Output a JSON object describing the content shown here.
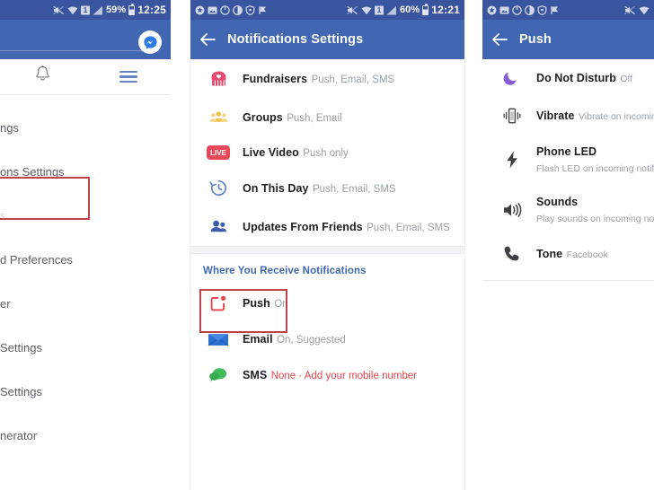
{
  "panels": {
    "left": {
      "status": {
        "battery": "59%",
        "clock": "12:25",
        "icons": [
          "mute-icon",
          "wifi-icon",
          "sim-icon",
          "signal-icon",
          "battery-icon"
        ]
      },
      "appbar": {
        "messenger_icon": "messenger-icon"
      },
      "tabs": [
        {
          "name": "notifications-tab",
          "icon": "bell-icon"
        },
        {
          "name": "menu-tab",
          "icon": "hamburger-icon"
        }
      ],
      "menu": [
        {
          "label": "ngs",
          "dim": false
        },
        {
          "label": "ons Settings",
          "dim": false,
          "highlighted": true
        },
        {
          "label": "s",
          "dim": true
        },
        {
          "label": "d Preferences",
          "dim": false
        },
        {
          "label": "er",
          "dim": false
        },
        {
          "label": "Settings",
          "dim": false
        },
        {
          "label": "Settings",
          "dim": false
        },
        {
          "label": "nerator",
          "dim": false
        }
      ]
    },
    "middle": {
      "status": {
        "battery": "60%",
        "clock": "12:21",
        "icons": [
          "star-icon",
          "image-icon",
          "power-icon",
          "pie-icon",
          "shield-icon",
          "flag-icon",
          "mute-icon",
          "wifi-icon",
          "sim-icon",
          "signal-icon",
          "battery-icon"
        ]
      },
      "appbar": {
        "back_icon": "back-arrow-icon",
        "title": "Notifications Settings"
      },
      "items": [
        {
          "icon": "fundraisers-icon",
          "title": "Fundraisers",
          "subtitle": "Push, Email, SMS"
        },
        {
          "icon": "groups-icon",
          "title": "Groups",
          "subtitle": "Push, Email"
        },
        {
          "icon": "live-video-icon",
          "title": "Live Video",
          "subtitle": "Push only"
        },
        {
          "icon": "on-this-day-icon",
          "title": "On This Day",
          "subtitle": "Push, Email, SMS"
        },
        {
          "icon": "updates-from-friends-icon",
          "title": "Updates From Friends",
          "subtitle": "Push, Email, SMS"
        }
      ],
      "section_title": "Where You Receive Notifications",
      "channels": [
        {
          "icon": "push-icon",
          "title": "Push",
          "subtitle": "On",
          "highlighted": true,
          "accent": false
        },
        {
          "icon": "email-icon",
          "title": "Email",
          "subtitle": "On, Suggested",
          "highlighted": false,
          "accent": false
        },
        {
          "icon": "sms-icon",
          "title": "SMS",
          "subtitle": "None · Add your mobile number",
          "highlighted": false,
          "accent": true
        }
      ]
    },
    "right": {
      "status": {
        "icons": [
          "star-icon",
          "image-icon",
          "power-icon",
          "pie-icon",
          "shield-icon",
          "flag-icon",
          "mute-icon",
          "wifi-icon"
        ]
      },
      "appbar": {
        "back_icon": "back-arrow-icon",
        "title": "Push"
      },
      "items": [
        {
          "icon": "do-not-disturb-icon",
          "title": "Do Not Disturb",
          "subtitle": "Off"
        },
        {
          "icon": "vibrate-icon",
          "title": "Vibrate",
          "subtitle": "Vibrate on incoming notifications"
        },
        {
          "icon": "phone-led-icon",
          "title": "Phone LED",
          "subtitle": "Flash LED on incoming notifications"
        },
        {
          "icon": "sounds-icon",
          "title": "Sounds",
          "subtitle": "Play sounds on incoming notifications"
        },
        {
          "icon": "tone-icon",
          "title": "Tone",
          "subtitle": "Facebook"
        }
      ]
    }
  },
  "colors": {
    "facebook_blue": "#4267b2",
    "status_blue": "#3a559f",
    "annotation_red": "#c0434c",
    "accent_red": "#e4444c",
    "section_blue": "#4267b2"
  }
}
